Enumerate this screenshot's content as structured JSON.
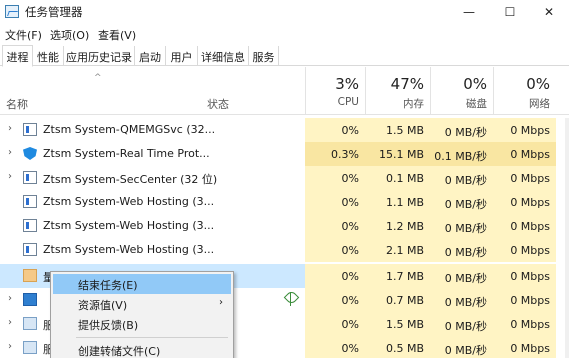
{
  "window": {
    "title": "任务管理器",
    "controls": {
      "minimize": "—",
      "maximize": "☐",
      "close": "✕"
    }
  },
  "menu": [
    "文件(F)",
    "选项(O)",
    "查看(V)"
  ],
  "tabs": [
    "进程",
    "性能",
    "应用历史记录",
    "启动",
    "用户",
    "详细信息",
    "服务"
  ],
  "header": {
    "name": "名称",
    "status": "状态",
    "sort_glyph": "^",
    "columns": [
      {
        "pct": "3%",
        "label": "CPU"
      },
      {
        "pct": "47%",
        "label": "内存"
      },
      {
        "pct": "0%",
        "label": "磁盘"
      },
      {
        "pct": "0%",
        "label": "网络"
      }
    ]
  },
  "rows": [
    {
      "name": "Ztsm System-QMEMGSvc (32...",
      "expand": "›",
      "icon": "window-icon",
      "cpu": "0%",
      "mem": "1.5 MB",
      "disk": "0 MB/秒",
      "net": "0 Mbps"
    },
    {
      "name": "Ztsm System-Real Time Prot...",
      "expand": "›",
      "icon": "shield-icon",
      "cpu": "0.3%",
      "mem": "15.1 MB",
      "disk": "0.1 MB/秒",
      "net": "0 Mbps"
    },
    {
      "name": "Ztsm System-SecCenter (32 位)",
      "expand": "›",
      "icon": "window-icon",
      "cpu": "0%",
      "mem": "0.1 MB",
      "disk": "0 MB/秒",
      "net": "0 Mbps"
    },
    {
      "name": "Ztsm System-Web Hosting (3...",
      "expand": "",
      "icon": "window-icon",
      "cpu": "0%",
      "mem": "1.1 MB",
      "disk": "0 MB/秒",
      "net": "0 Mbps"
    },
    {
      "name": "Ztsm System-Web Hosting (3...",
      "expand": "",
      "icon": "window-icon",
      "cpu": "0%",
      "mem": "1.2 MB",
      "disk": "0 MB/秒",
      "net": "0 Mbps"
    },
    {
      "name": "Ztsm System-Web Hosting (3...",
      "expand": "",
      "icon": "window-icon",
      "cpu": "0%",
      "mem": "2.1 MB",
      "disk": "0 MB/秒",
      "net": "0 Mbps"
    },
    {
      "name": "量",
      "expand": "",
      "icon": "app-icon",
      "cpu": "0%",
      "mem": "1.7 MB",
      "disk": "0 MB/秒",
      "net": "0 Mbps"
    },
    {
      "name": "",
      "expand": "›",
      "icon": "blue-app-icon",
      "cpu": "0%",
      "mem": "0.7 MB",
      "disk": "0 MB/秒",
      "net": "0 Mbps"
    },
    {
      "name": "服",
      "expand": "›",
      "icon": "gear-icon",
      "cpu": "0%",
      "mem": "1.5 MB",
      "disk": "0 MB/秒",
      "net": "0 Mbps"
    },
    {
      "name": "服",
      "expand": "›",
      "icon": "gear-icon",
      "cpu": "0%",
      "mem": "0.5 MB",
      "disk": "0 MB/秒",
      "net": "0 Mbps"
    }
  ],
  "context_menu": {
    "items": [
      {
        "label": "结束任务(E)"
      },
      {
        "label": "资源值(V)",
        "arrow": "›"
      },
      {
        "label": "提供反馈(B)"
      },
      {
        "label": "创建转储文件(C)"
      }
    ]
  },
  "colors": {
    "cpu_highlight": "#f9e6a2",
    "cell_bg": "#fff4c4",
    "selected_row": "#cce8ff",
    "menu_hover": "#91c9f7"
  }
}
